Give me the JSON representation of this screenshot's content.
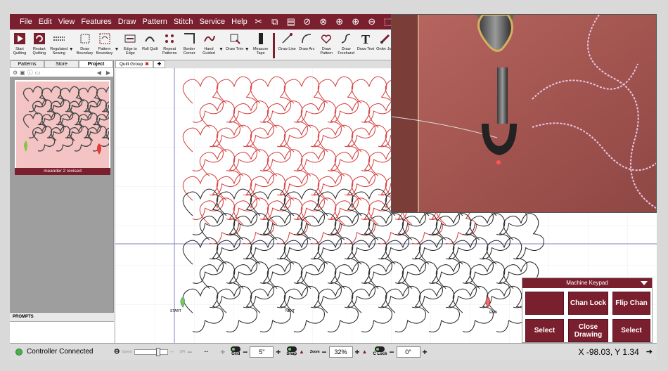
{
  "menu": [
    "File",
    "Edit",
    "View",
    "Features",
    "Draw",
    "Pattern",
    "Stitch",
    "Service",
    "Help"
  ],
  "toolbar": [
    {
      "label": "Start Quilting",
      "icon": "play-icon"
    },
    {
      "label": "Restart Quilting",
      "icon": "restart-icon"
    },
    {
      "label": "Regulated Sewing",
      "icon": "regulated-sewing-icon"
    },
    {
      "label": "Draw Boundary",
      "icon": "draw-boundary-icon"
    },
    {
      "label": "Pattern Boundary",
      "icon": "pattern-boundary-icon"
    },
    {
      "label": "Edge to Edge",
      "icon": "edge-to-edge-icon"
    },
    {
      "label": "Roll Quilt",
      "icon": "roll-quilt-icon"
    },
    {
      "label": "Repeat Patterns",
      "icon": "repeat-patterns-icon"
    },
    {
      "label": "Border Corner",
      "icon": "border-corner-icon"
    },
    {
      "label": "Hand Guided",
      "icon": "hand-guided-icon"
    },
    {
      "label": "Draw Trim",
      "icon": "draw-trim-icon"
    },
    {
      "label": "Measure Tape",
      "icon": "measure-tape-icon"
    },
    {
      "label": "Draw Line",
      "icon": "draw-line-icon"
    },
    {
      "label": "Draw Arc",
      "icon": "draw-arc-icon"
    },
    {
      "label": "Draw Pattern",
      "icon": "draw-pattern-icon"
    },
    {
      "label": "Draw Freehand",
      "icon": "draw-freehand-icon"
    },
    {
      "label": "Draw Text",
      "icon": "draw-text-icon"
    },
    {
      "label": "Order Join",
      "icon": "order-join-icon"
    }
  ],
  "left_tabs": [
    "Patterns",
    "Store",
    "Project"
  ],
  "pattern_name": "meander 2 revised",
  "prompts_title": "PROMPTS",
  "doc_tab": "Quilt Group",
  "canvas": {
    "start_label": "START",
    "next_label": "NEXT",
    "end_label": "END"
  },
  "status": {
    "connection": "Controller Connected",
    "speed_label": "Speed",
    "spi_label": "SPI",
    "spi_value": "--",
    "grid_label": "Grid",
    "grid_value": "5\"",
    "snap_label": "Snap",
    "zoom_label": "Zoom",
    "zoom_value": "32%",
    "clock_label": "C Lock",
    "clock_value": "0°",
    "coords": "X -98.03, Y 1.34"
  },
  "keypad": {
    "title": "Machine Keypad",
    "buttons": [
      "",
      "Chan Lock",
      "Flip Chan",
      "Select",
      "Close Drawing",
      "Select"
    ]
  },
  "colors": {
    "accent": "#7a1f2e",
    "pattern_red": "#d43a3a",
    "pattern_black": "#222222",
    "fabric": "#a85a55"
  }
}
